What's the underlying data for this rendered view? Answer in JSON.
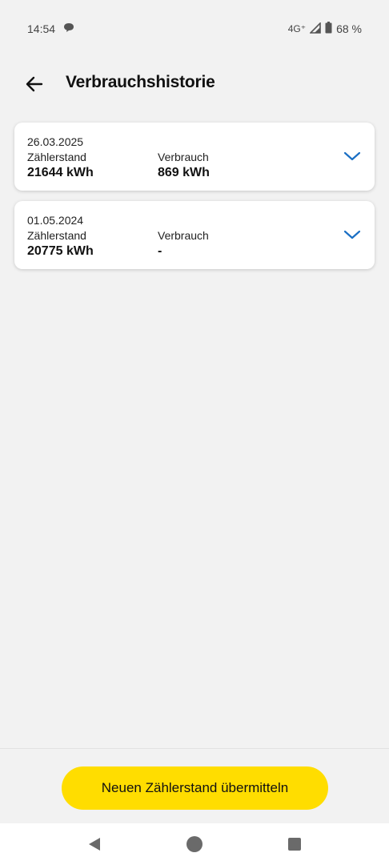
{
  "status_bar": {
    "time": "14:54",
    "network": "4G⁺",
    "battery": "68 %"
  },
  "header": {
    "title": "Verbrauchshistorie"
  },
  "entries": [
    {
      "date": "26.03.2025",
      "meter_label": "Zählerstand",
      "meter_value": "21644 kWh",
      "usage_label": "Verbrauch",
      "usage_value": "869 kWh"
    },
    {
      "date": "01.05.2024",
      "meter_label": "Zählerstand",
      "meter_value": "20775 kWh",
      "usage_label": "Verbrauch",
      "usage_value": "-"
    }
  ],
  "actions": {
    "submit_label": "Neuen Zählerstand übermitteln"
  },
  "colors": {
    "accent": "#ffdd00",
    "chevron": "#1a6fc4",
    "background": "#f2f2f2"
  },
  "icons": [
    "speech-bubble-icon",
    "signal-icon",
    "battery-icon",
    "back-arrow-icon",
    "chevron-down-icon"
  ]
}
